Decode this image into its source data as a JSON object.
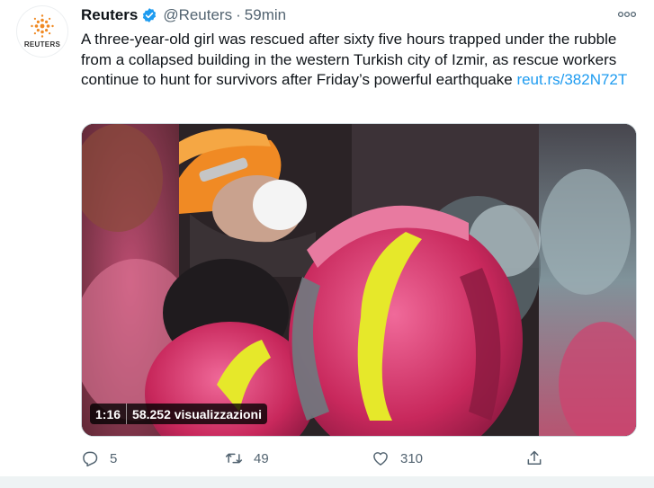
{
  "tweet": {
    "author_name": "Reuters",
    "handle": "@Reuters",
    "separator": "·",
    "time": "59min",
    "avatar_text": "REUTERS",
    "more_label": "ooo",
    "text": "A three-year-old girl was rescued after sixty five hours trapped under the rubble from a collapsed building in the western Turkish city of Izmir, as rescue workers continue to hunt for survivors after Friday’s powerful earthquake ",
    "link": "reut.rs/382N72T"
  },
  "video": {
    "duration": "1:16",
    "views": "58.252 visualizzazioni"
  },
  "actions": {
    "reply_icon": "reply-icon",
    "reply_count": "5",
    "retweet_icon": "retweet-icon",
    "retweet_count": "49",
    "like_icon": "heart-icon",
    "like_count": "310",
    "share_icon": "share-icon"
  },
  "colors": {
    "accent": "#1d9bf0",
    "secondary_text": "#536471",
    "helmet_pink": "#d8336a",
    "helmet_orange": "#f08a24",
    "stripe_yellow": "#e6e82a"
  }
}
